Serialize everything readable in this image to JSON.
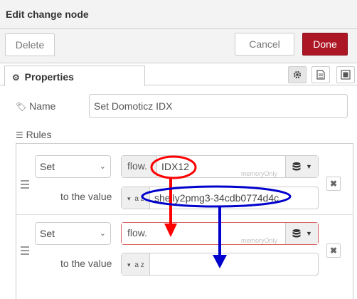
{
  "dialog": {
    "title": "Edit change node"
  },
  "toolbar": {
    "delete_label": "Delete",
    "cancel_label": "Cancel",
    "done_label": "Done"
  },
  "tabs": {
    "properties_label": "Properties"
  },
  "form": {
    "name_label": "Name",
    "name_value": "Set Domoticz IDX",
    "rules_label": "Rules"
  },
  "rules": [
    {
      "action": "Set",
      "target_type": "flow.",
      "target_value": "IDX12",
      "context_store": "memoryOnly",
      "to_label": "to the value",
      "value_type": "a z",
      "value": "shelly2pmg3-34cdb0774d4c"
    },
    {
      "action": "Set",
      "target_type": "flow.",
      "target_value": "",
      "context_store": "memoryOnly",
      "to_label": "to the value",
      "value_type": "a z",
      "value": ""
    }
  ],
  "colors": {
    "done": "#ad1625",
    "red_annotation": "#ff0000",
    "blue_annotation": "#0000ff"
  }
}
